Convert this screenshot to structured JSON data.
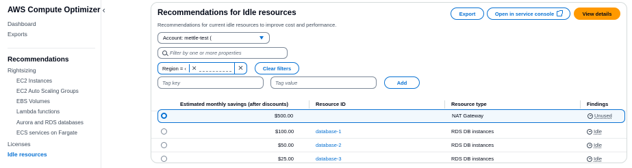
{
  "sidebar": {
    "title": "AWS Compute Optimizer",
    "collapse_icon": "chevron-left-icon",
    "links": {
      "dashboard": "Dashboard",
      "exports": "Exports"
    },
    "section": "Recommendations",
    "rightsizing": "Rightsizing",
    "sub_items": [
      "EC2 Instances",
      "EC2 Auto Scaling Groups",
      "EBS Volumes",
      "Lambda functions",
      "Aurora and RDS databases",
      "ECS services on Fargate"
    ],
    "licenses": "Licenses",
    "idle_resources": "Idle resources"
  },
  "panel": {
    "title": "Recommendations for Idle resources",
    "subtitle": "Recommendations for current idle resources to improve cost and performance.",
    "buttons": {
      "export": "Export",
      "console": "Open in service console",
      "details": "View details"
    },
    "account_select": "Account: mettle-test (",
    "filter_placeholder": "Filter by one or more properties",
    "token_label": "Region = ‹",
    "clear_filters": "Clear filters",
    "tag_key_placeholder": "Tag key",
    "tag_value_placeholder": "Tag value",
    "add": "Add"
  },
  "table": {
    "headers": [
      "Estimated monthly savings (after discounts)",
      "Resource ID",
      "Resource type",
      "Findings"
    ],
    "rows": [
      {
        "savings": "$500.00",
        "resource_id": "",
        "type": "NAT Gateway",
        "finding": "Unused",
        "selected": true
      },
      {
        "savings": "$100.00",
        "resource_id": "database-1",
        "type": "RDS DB instances",
        "finding": "Idle",
        "selected": false
      },
      {
        "savings": "$50.00",
        "resource_id": "database-2",
        "type": "RDS DB instances",
        "finding": "Idle",
        "selected": false
      },
      {
        "savings": "$25.00",
        "resource_id": "database-3",
        "type": "RDS DB instances",
        "finding": "Idle",
        "selected": false
      }
    ]
  },
  "colors": {
    "primary": "#0972d3",
    "accent": "#ff9900",
    "text": "#000716"
  }
}
